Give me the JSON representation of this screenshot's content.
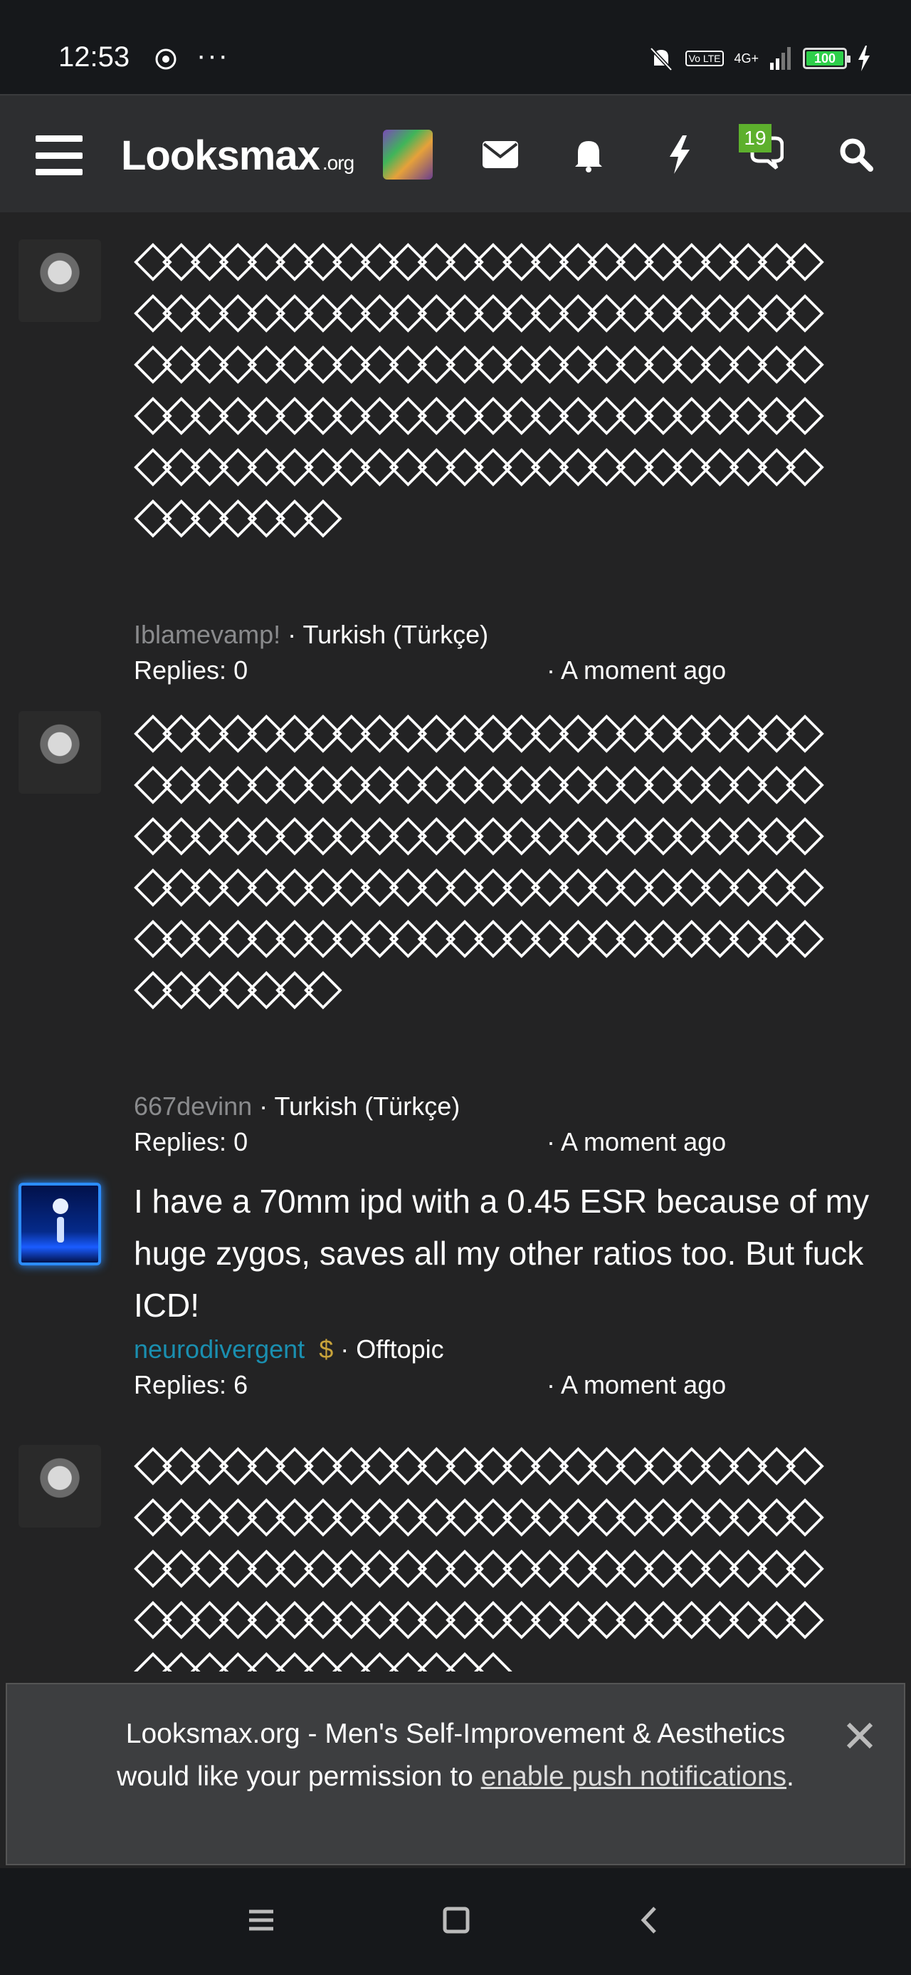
{
  "status_bar": {
    "time": "12:53",
    "dots": "···",
    "network": "4G+",
    "volte": "Vo LTE",
    "battery": "100"
  },
  "header": {
    "logo_main": "Looksmax",
    "logo_suffix": ".org",
    "conversations_badge": "19"
  },
  "posts": [
    {
      "content": "◇◇◇◇◇◇◇◇◇◇◇◇◇◇◇◇◇◇◇◇◇◇◇◇◇◇◇◇◇◇◇◇◇◇◇◇◇◇◇◇◇◇◇◇◇◇◇◇◇◇◇◇◇◇◇◇◇◇◇◇◇◇◇◇◇◇◇◇◇◇◇◇◇◇◇◇◇◇◇◇◇◇◇◇◇◇◇◇◇◇◇◇◇◇◇◇◇◇◇◇◇◇◇◇◇◇◇◇◇◇◇◇◇◇◇◇◇◇◇◇◇◇◇◇◇◇◇",
      "author": "Iblamevamp!",
      "forum": "Turkish (Türkçe)",
      "replies": "Replies: 0",
      "time": "· A moment ago"
    },
    {
      "content": "◇◇◇◇◇◇◇◇◇◇◇◇◇◇◇◇◇◇◇◇◇◇◇◇◇◇◇◇◇◇◇◇◇◇◇◇◇◇◇◇◇◇◇◇◇◇◇◇◇◇◇◇◇◇◇◇◇◇◇◇◇◇◇◇◇◇◇◇◇◇◇◇◇◇◇◇◇◇◇◇◇◇◇◇◇◇◇◇◇◇◇◇◇◇◇◇◇◇◇◇◇◇◇◇◇◇◇◇◇◇◇◇◇◇◇◇◇◇◇◇◇◇◇◇◇◇◇",
      "author": "667devinn",
      "forum": "Turkish (Türkçe)",
      "replies": "Replies: 0",
      "time": "· A moment ago"
    },
    {
      "title": "I have a 70mm ipd with a 0.45 ESR because of my huge zygos, saves all my other ratios too. But fuck ICD!",
      "author": "neurodivergent",
      "author_badge": "$",
      "forum": "Offtopic",
      "replies": "Replies: 6",
      "time": "· A moment ago"
    },
    {
      "content": "◇◇◇◇◇◇◇◇◇◇◇◇◇◇◇◇◇◇◇◇◇◇◇◇◇◇◇◇◇◇◇◇◇◇◇◇◇◇◇◇◇◇◇◇◇◇◇◇◇◇◇◇◇◇◇◇◇◇◇◇◇◇◇◇◇◇◇◇◇◇◇◇◇◇◇◇◇◇◇◇◇◇◇◇◇◇◇◇◇◇◇◇◇◇◇◇◇◇◇◇◇◇◇◇◇◇◇◇◇"
    }
  ],
  "push_banner": {
    "line1": "Looksmax.org - Men's Self-Improvement & Aesthetics",
    "line2_prefix": "would like your permission to ",
    "link": "enable push notifications",
    "line2_suffix": "."
  }
}
